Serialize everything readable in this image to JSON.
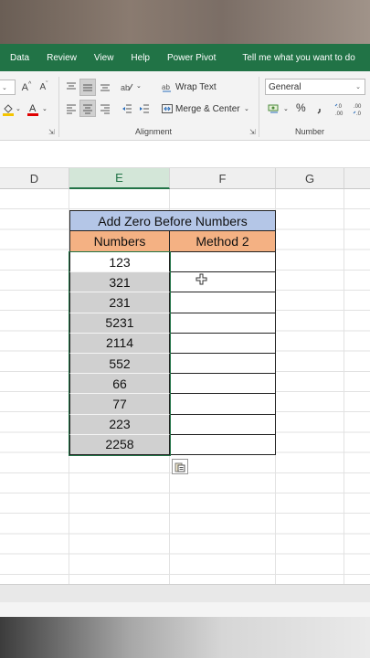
{
  "menu": {
    "items": [
      "Data",
      "Review",
      "View",
      "Help",
      "Power Pivot"
    ],
    "tell_me": "Tell me what you want to do"
  },
  "ribbon": {
    "font_size_up": "A",
    "font_size_down": "A",
    "wrap_text": "Wrap Text",
    "merge_center": "Merge & Center",
    "number_format": "General",
    "percent": "%",
    "alignment_group": "Alignment",
    "number_group": "Number"
  },
  "columns": [
    "D",
    "E",
    "F",
    "G"
  ],
  "active_column": "E",
  "table": {
    "title": "Add Zero Before Numbers",
    "headers": [
      "Numbers",
      "Method 2"
    ],
    "numbers": [
      "123",
      "321",
      "231",
      "5231",
      "2114",
      "552",
      "66",
      "77",
      "223",
      "2258"
    ]
  },
  "colors": {
    "excel_green": "#217346",
    "title_fill": "#b4c6e7",
    "header_fill": "#f4b183",
    "selection_fill": "#d0d0d0"
  }
}
